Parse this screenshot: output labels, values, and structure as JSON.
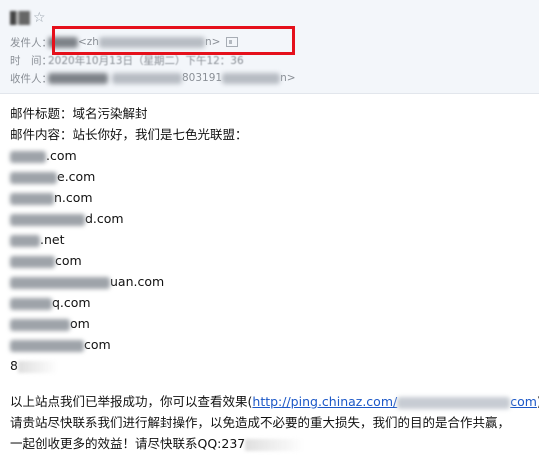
{
  "header": {
    "from_label": "发件人：",
    "from_email_prefix": "<zh",
    "from_email_suffix": "n>",
    "time_label": "时　间：",
    "time_value": "2020年10月13日（星期二）下午12：36",
    "to_label": "收件人：",
    "to_email_mid": "803191",
    "to_email_suffix": "n>"
  },
  "body": {
    "subject_line": "邮件标题：域名污染解封",
    "content_line": "邮件内容：站长你好，我们是七色光联盟：",
    "domains": [
      {
        "tail": ".com"
      },
      {
        "tail": "e.com"
      },
      {
        "tail": "n.com"
      },
      {
        "tail": "d.com"
      },
      {
        "tail": ".net"
      },
      {
        "tail": "com"
      },
      {
        "tail": "uan.com"
      },
      {
        "tail": "q.com"
      },
      {
        "tail": "om"
      },
      {
        "tail": "com"
      },
      {
        "tail": "8"
      }
    ],
    "report_text": "以上站点我们已举报成功，你可以查看效果(",
    "report_link_prefix": "http://ping.chinaz.com/",
    "report_link_suffix": "com",
    "report_close": ")",
    "request_line": "请贵站尽快联系我们进行解封操作，以免造成不必要的重大损失，我们的目的是合作共赢，",
    "closing_line": "一起创收更多的效益！请尽快联系QQ:237"
  }
}
